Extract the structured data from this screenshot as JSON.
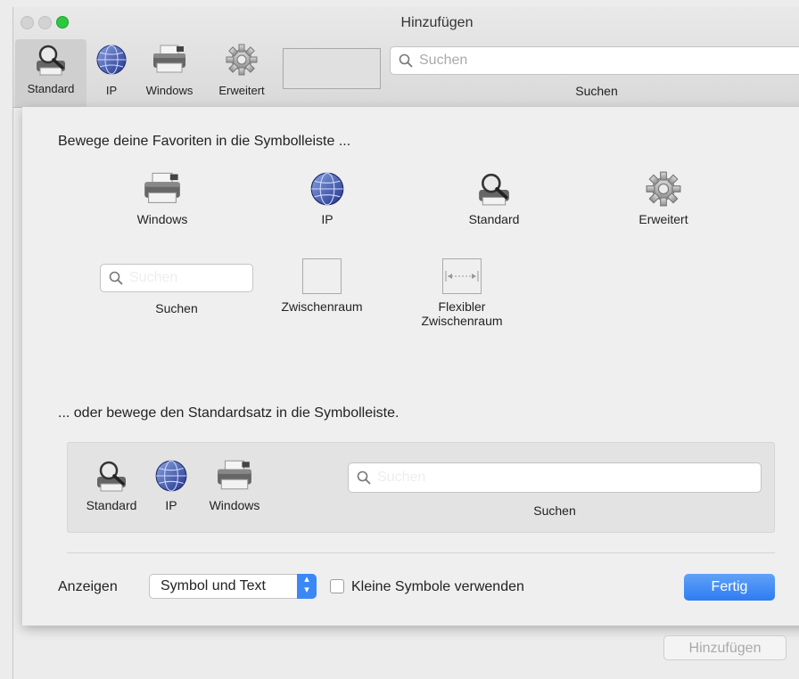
{
  "window": {
    "title": "Hinzufügen"
  },
  "toolbar": {
    "items": [
      {
        "label": "Standard",
        "icon": "magnifier-printer-icon"
      },
      {
        "label": "IP",
        "icon": "globe-icon"
      },
      {
        "label": "Windows",
        "icon": "printer-icon"
      },
      {
        "label": "Erweitert",
        "icon": "gear-icon"
      }
    ],
    "search_placeholder": "Suchen",
    "search_label": "Suchen"
  },
  "sheet": {
    "favorites_heading": "Bewege deine Favoriten in die Symbolleiste ...",
    "palette": {
      "windows": "Windows",
      "ip": "IP",
      "standard": "Standard",
      "erweitert": "Erweitert",
      "search_placeholder": "Suchen",
      "search_label": "Suchen",
      "space": "Zwischenraum",
      "flex_space": "Flexibler Zwischenraum"
    },
    "default_heading": "... oder bewege den Standardsatz in die Symbolleiste.",
    "default_set": {
      "standard": "Standard",
      "ip": "IP",
      "windows": "Windows",
      "search_placeholder": "Suchen",
      "search_label": "Suchen"
    },
    "show_label": "Anzeigen",
    "show_value": "Symbol und Text",
    "small_icons_label": "Kleine Symbole verwenden",
    "small_icons_checked": false,
    "done_button": "Fertig"
  },
  "add_button": "Hinzufügen",
  "colors": {
    "accent": "#2f7cf2",
    "zoom": "#2bc840"
  }
}
